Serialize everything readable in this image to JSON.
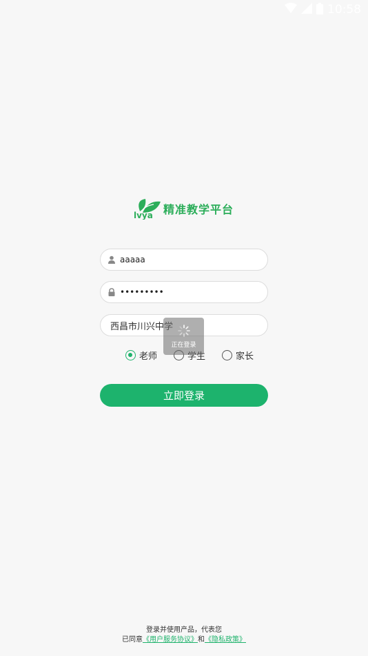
{
  "status_bar": {
    "time": "10:58",
    "icons": [
      "wifi-icon",
      "signal-icon",
      "battery-icon"
    ]
  },
  "logo": {
    "mark_text": "lvya",
    "title": "精准教学平台"
  },
  "form": {
    "username_value": "aaaaa",
    "password_value": "•••••••••",
    "school_value": "西昌市川兴中学",
    "roles": [
      {
        "label": "老师",
        "selected": true
      },
      {
        "label": "学生",
        "selected": false
      },
      {
        "label": "家长",
        "selected": false
      }
    ],
    "login_label": "立即登录"
  },
  "loading": {
    "text": "正在登录"
  },
  "footer": {
    "line1": "登录并使用产品，代表您",
    "agree_prefix": "已同意",
    "user_agreement": "《用户服务协议》",
    "and_text": "和",
    "privacy_policy": "《隐私政策》"
  },
  "colors": {
    "accent": "#1db36d",
    "logo_green": "#2cae5a",
    "background": "#f7f7f7"
  }
}
